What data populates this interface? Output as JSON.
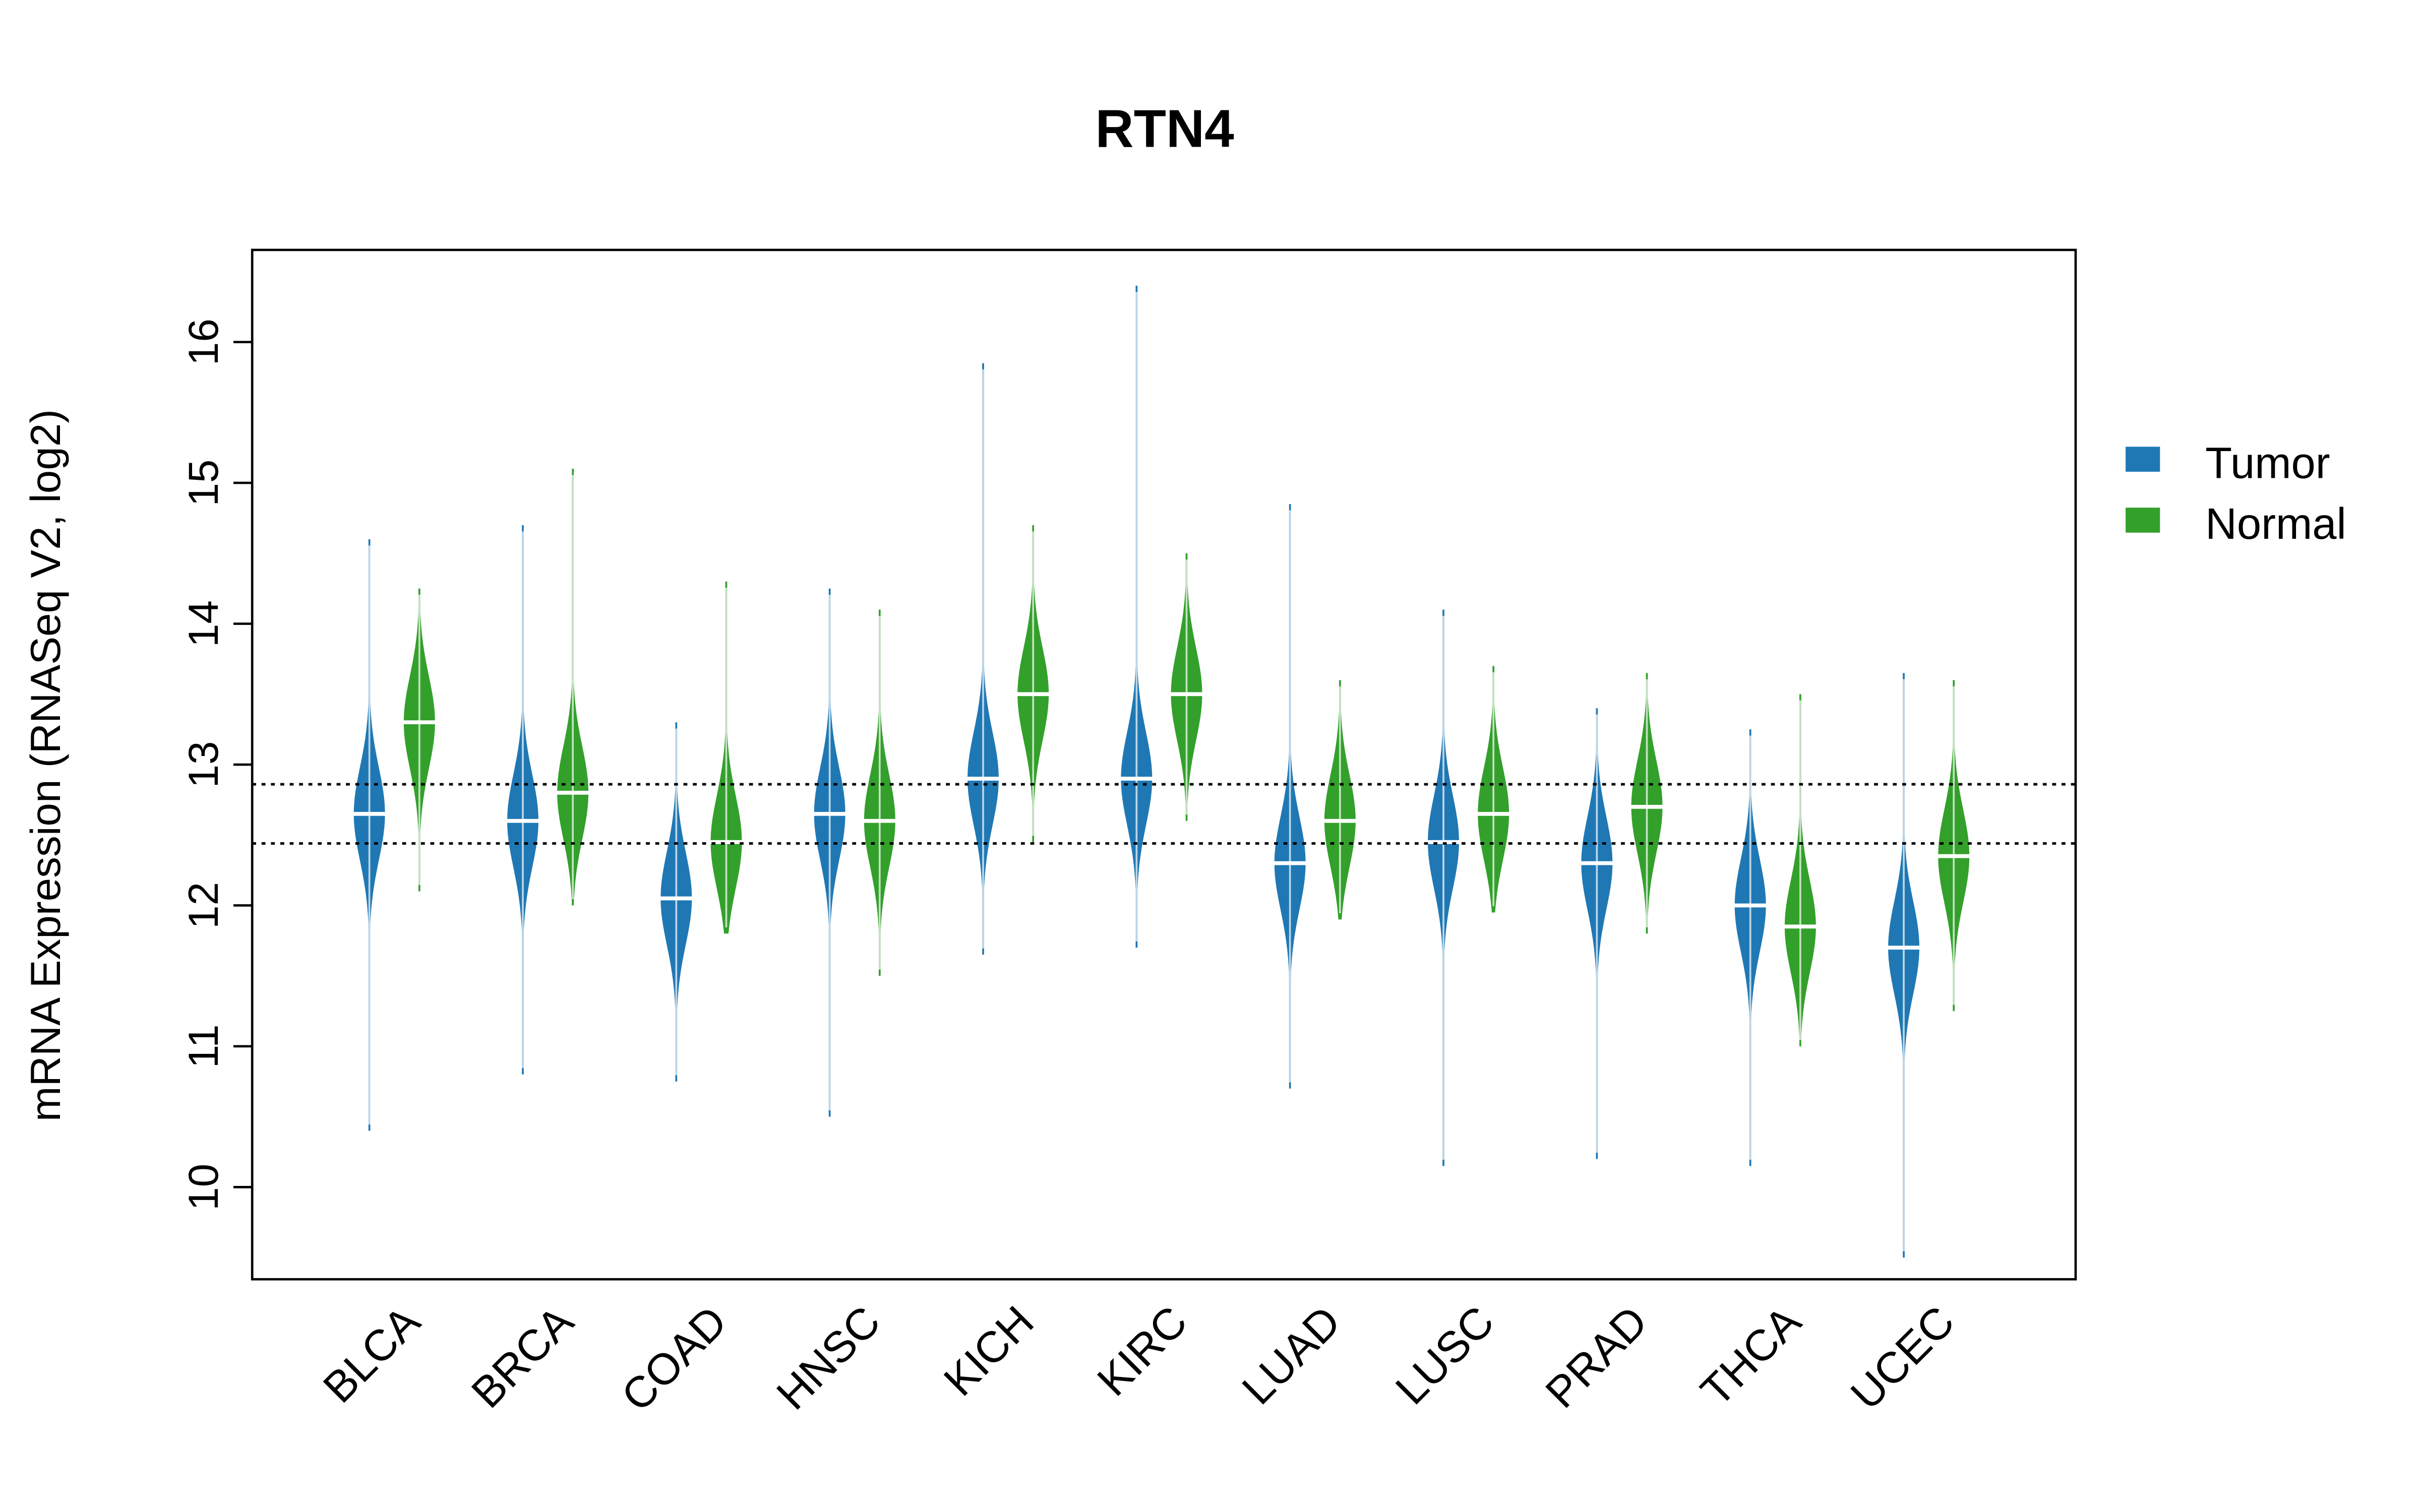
{
  "chart_data": {
    "type": "violin",
    "title": "RTN4",
    "xlabel": "",
    "ylabel": "mRNA Expression (RNASeq V2, log2)",
    "ylim": [
      9.35,
      16.65
    ],
    "yticks": [
      10,
      11,
      12,
      13,
      14,
      15,
      16
    ],
    "grid": false,
    "reference_lines": [
      12.86,
      12.44
    ],
    "legend": {
      "position": "right",
      "entries": [
        {
          "label": "Tumor",
          "color": "#1f78b4"
        },
        {
          "label": "Normal",
          "color": "#33a02c"
        }
      ]
    },
    "categories": [
      "BLCA",
      "BRCA",
      "COAD",
      "HNSC",
      "KICH",
      "KIRC",
      "LUAD",
      "LUSC",
      "PRAD",
      "THCA",
      "UCEC"
    ],
    "series": [
      {
        "name": "Tumor",
        "color": "#1f78b4",
        "median": [
          12.65,
          12.6,
          12.05,
          12.65,
          12.9,
          12.9,
          12.3,
          12.45,
          12.3,
          12.0,
          11.7
        ],
        "min": [
          10.4,
          10.8,
          10.75,
          10.5,
          11.65,
          11.7,
          10.7,
          10.15,
          10.2,
          10.15,
          9.5
        ],
        "max": [
          14.6,
          14.7,
          13.3,
          14.25,
          15.85,
          16.4,
          14.85,
          14.1,
          13.4,
          13.25,
          13.65
        ]
      },
      {
        "name": "Normal",
        "color": "#33a02c",
        "median": [
          13.3,
          12.8,
          12.45,
          12.6,
          13.5,
          13.5,
          12.6,
          12.65,
          12.7,
          11.85,
          12.35
        ],
        "min": [
          12.1,
          12.0,
          11.8,
          11.5,
          12.45,
          12.6,
          11.9,
          11.95,
          11.8,
          11.0,
          11.25
        ],
        "max": [
          14.25,
          15.1,
          14.3,
          14.1,
          14.7,
          14.5,
          13.6,
          13.7,
          13.65,
          13.5,
          13.6
        ]
      }
    ]
  }
}
